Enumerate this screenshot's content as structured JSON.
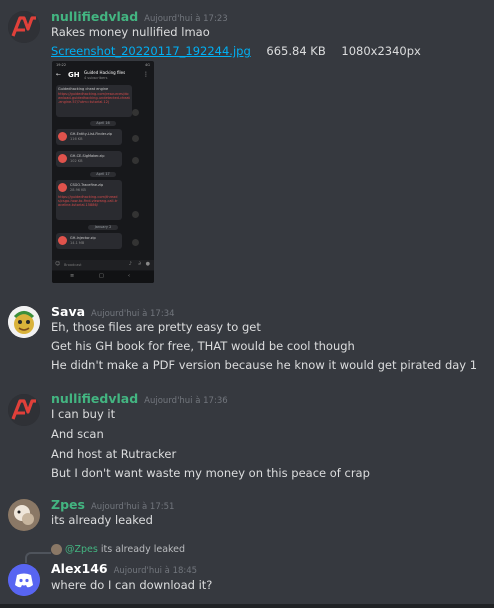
{
  "messages": [
    {
      "author": "nullifiedvlad",
      "timestamp": "Aujourd'hui à 17:23",
      "lines": [
        "Rakes money nullified lmao"
      ],
      "attachment": {
        "filename": "Screenshot_20220117_192244.jpg",
        "size": "665.84 KB",
        "dimensions": "1080x2340px"
      }
    },
    {
      "author": "Sava",
      "timestamp": "Aujourd'hui à 17:34",
      "lines": [
        "Eh, those files are pretty easy to get",
        "Get his GH book for free, THAT would be cool though",
        "He didn't make a PDF version because he know it would get pirated day 1"
      ]
    },
    {
      "author": "nullifiedvlad",
      "timestamp": "Aujourd'hui à 17:36",
      "lines": [
        "I can buy it",
        "And scan",
        "And host at Rutracker",
        "But I don't want waste my money on this peace of crap"
      ]
    },
    {
      "author": "Zpes",
      "timestamp": "Aujourd'hui à 17:51",
      "lines": [
        "its already leaked"
      ]
    },
    {
      "author": "Alex146",
      "timestamp": "Aujourd'hui à 18:45",
      "lines": [
        "where do I can download it?"
      ],
      "reply": {
        "mention": "@Zpes",
        "text": "its already leaked"
      }
    }
  ],
  "phone": {
    "status_left": "19:22",
    "status_right": "4G",
    "channel_title": "Guided Hacking files",
    "channel_subtitle": "4 subscribers",
    "intro_text": "Guidedhacking cheat engine",
    "intro_link": "https://guidedhacking.com/resources/download-guidedhacking-undetected-cheat-engine.57/?utm=tutorial.12)",
    "dates": [
      "April 16",
      "April 17",
      "January 2"
    ],
    "files": [
      {
        "name": "GH-Entity-List-Finder.zip",
        "size": "116 KB"
      },
      {
        "name": "GH-CE-SigMaker.zip",
        "size": "102 KB"
      },
      {
        "name": "CSGO-Tracefine.zip",
        "size": "28.96 KB"
      },
      {
        "name": "GH-Injector.zip",
        "size": "14.1 MB"
      }
    ],
    "file3_link": "https://guidedhacking.com/threads/csgo-how-to-find-viewang-call-traceline-tutorial.15886/",
    "composer_placeholder": "Broadcast"
  },
  "colors": {
    "background": "#36393f",
    "author_green": "#43b581",
    "author_white": "#ffffff",
    "link": "#00b0f4",
    "timestamp": "#72767d"
  }
}
